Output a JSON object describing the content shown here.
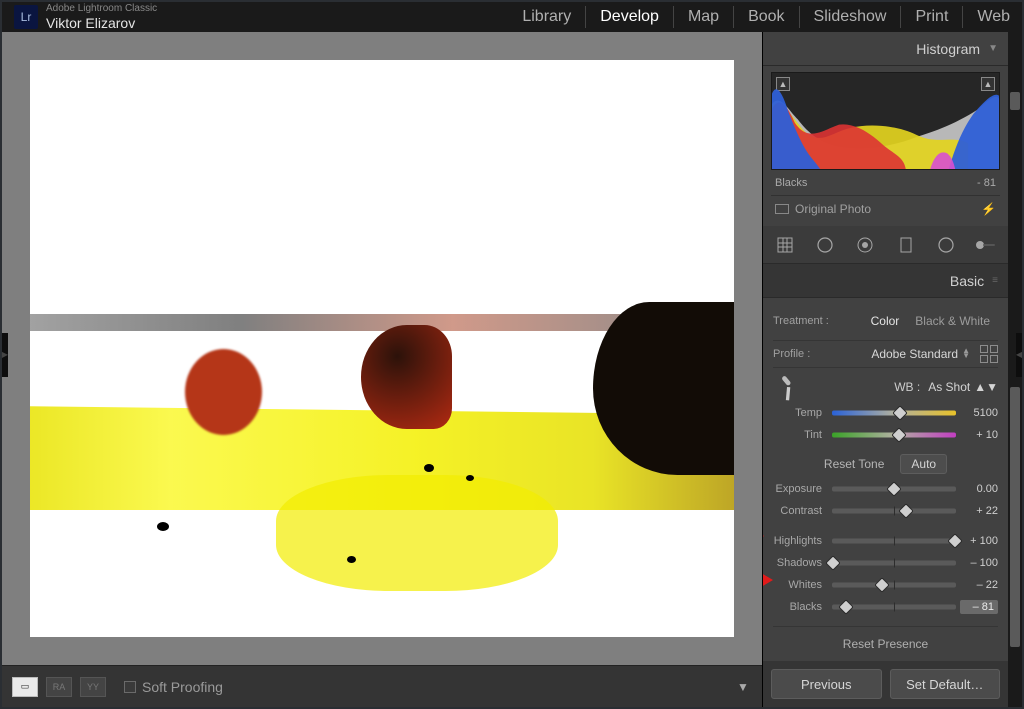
{
  "app": {
    "short": "Lr",
    "name": "Adobe Lightroom Classic",
    "user": "Viktor Elizarov"
  },
  "nav": {
    "library": "Library",
    "develop": "Develop",
    "map": "Map",
    "book": "Book",
    "slideshow": "Slideshow",
    "print": "Print",
    "web": "Web"
  },
  "softproof": "Soft Proofing",
  "viewmodes": {
    "ra": "RA",
    "yy": "YY"
  },
  "histogram": {
    "title": "Histogram",
    "label": "Blacks",
    "value": "- 81",
    "original": "Original Photo"
  },
  "basic": {
    "title": "Basic",
    "treatment": "Treatment :",
    "color": "Color",
    "bw": "Black & White",
    "profile": "Profile :",
    "profile_value": "Adobe Standard",
    "wb_label": "WB :",
    "wb_value": "As Shot",
    "temp": {
      "label": "Temp",
      "value": "5100",
      "thumb": 55
    },
    "tint": {
      "label": "Tint",
      "value": "+ 10",
      "thumb": 54
    },
    "reset_tone": "Reset Tone",
    "auto": "Auto",
    "exposure": {
      "label": "Exposure",
      "value": "0.00",
      "thumb": 50
    },
    "contrast": {
      "label": "Contrast",
      "value": "+ 22",
      "thumb": 60
    },
    "highlights": {
      "label": "Highlights",
      "value": "+ 100",
      "thumb": 99
    },
    "shadows": {
      "label": "Shadows",
      "value": "– 100",
      "thumb": 1
    },
    "whites": {
      "label": "Whites",
      "value": "– 22",
      "thumb": 40
    },
    "blacks": {
      "label": "Blacks",
      "value": "– 81",
      "thumb": 11,
      "highlight": true
    },
    "reset_presence": "Reset Presence"
  },
  "buttons": {
    "previous": "Previous",
    "setdefault": "Set Default…"
  }
}
